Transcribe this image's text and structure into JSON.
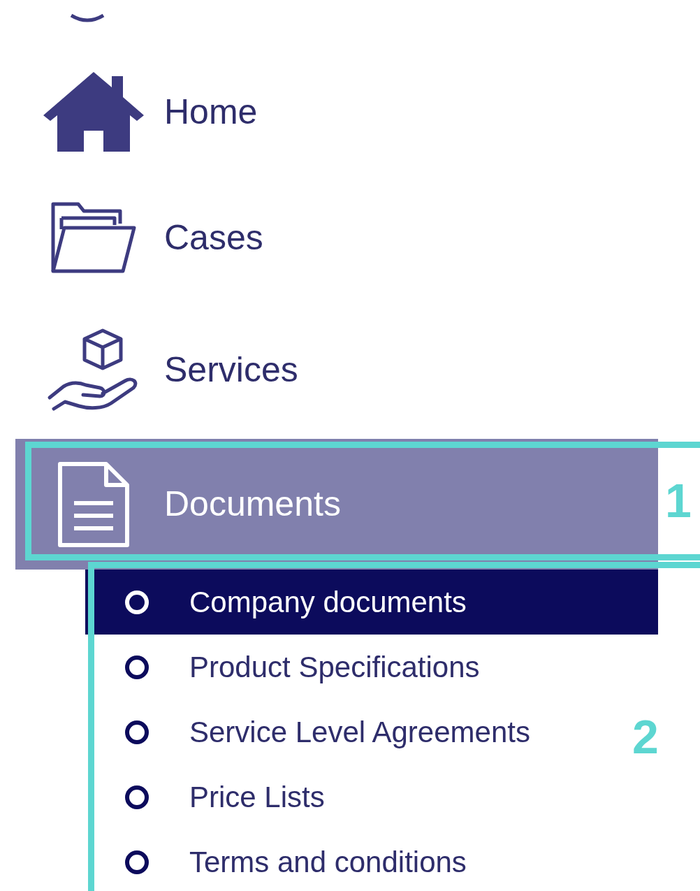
{
  "menu": {
    "items": [
      {
        "label": "Home",
        "selected": false
      },
      {
        "label": "Cases",
        "selected": false
      },
      {
        "label": "Services",
        "selected": false
      },
      {
        "label": "Documents",
        "selected": true,
        "expanded": true,
        "children": [
          {
            "label": "Company documents",
            "selected": true
          },
          {
            "label": "Product Specifications",
            "selected": false
          },
          {
            "label": "Service Level Agreements",
            "selected": false
          },
          {
            "label": "Price Lists",
            "selected": false
          },
          {
            "label": "Terms and conditions",
            "selected": false
          }
        ]
      }
    ]
  },
  "annotations": [
    {
      "label": "1"
    },
    {
      "label": "2"
    }
  ]
}
